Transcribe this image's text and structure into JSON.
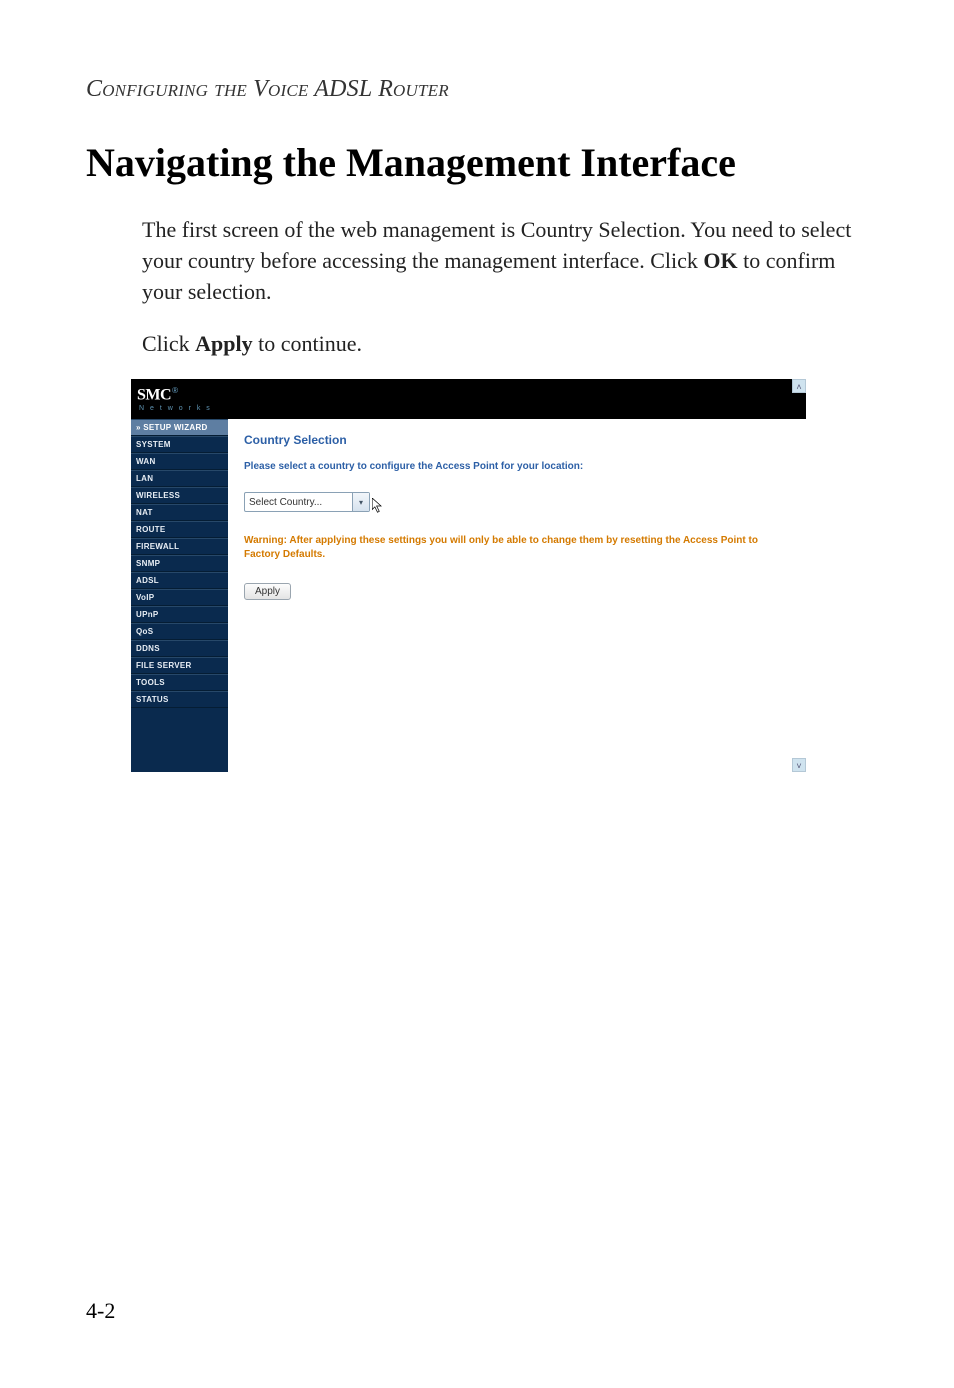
{
  "running_head": "Configuring the Voice ADSL Router",
  "section_title": "Navigating the Management Interface",
  "para1_pre": "The first screen of the web management is Country Selection. You need to select your country before accessing the management interface. Click ",
  "para1_bold": "OK",
  "para1_post": " to confirm your selection.",
  "para2_pre": "Click ",
  "para2_bold": "Apply",
  "para2_post": " to continue.",
  "page_number": "4-2",
  "screenshot": {
    "logo_main": "SMC",
    "logo_reg": "®",
    "logo_sub": "N e t w o r k s",
    "nav": [
      "» SETUP WIZARD",
      "SYSTEM",
      "WAN",
      "LAN",
      "WIRELESS",
      "NAT",
      "ROUTE",
      "FIREWALL",
      "SNMP",
      "ADSL",
      "VoIP",
      "UPnP",
      "QoS",
      "DDNS",
      "FILE SERVER",
      "TOOLS",
      "STATUS"
    ],
    "title": "Country Selection",
    "instruction": "Please select a country to configure the Access Point for your location:",
    "select_value": "Select Country...",
    "warning": "Warning: After applying these settings you will only be able to change them by resetting the Access Point to Factory Defaults.",
    "apply_label": "Apply"
  }
}
